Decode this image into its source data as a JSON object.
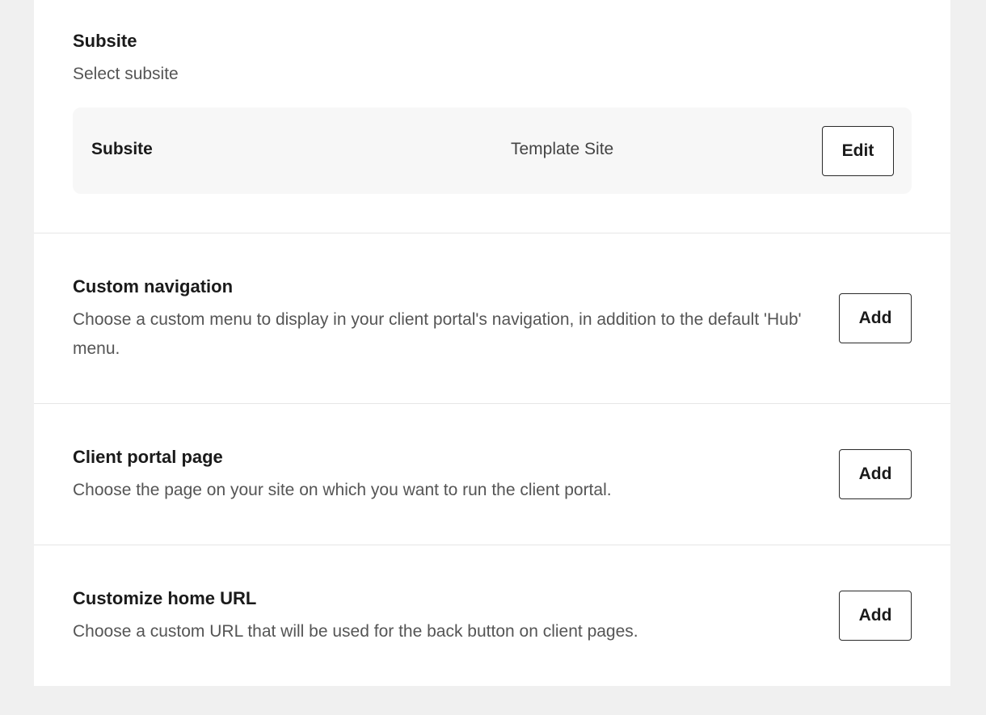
{
  "subsite": {
    "title": "Subsite",
    "description": "Select subsite",
    "row_label": "Subsite",
    "row_value": "Template Site",
    "edit_label": "Edit"
  },
  "custom_navigation": {
    "title": "Custom navigation",
    "description": "Choose a custom menu to display in your client portal's navigation, in addition to the default 'Hub' menu.",
    "add_label": "Add"
  },
  "client_portal_page": {
    "title": "Client portal page",
    "description": "Choose the page on your site on which you want to run the client portal.",
    "add_label": "Add"
  },
  "customize_home_url": {
    "title": "Customize home URL",
    "description": "Choose a custom URL that will be used for the back button on client pages.",
    "add_label": "Add"
  }
}
